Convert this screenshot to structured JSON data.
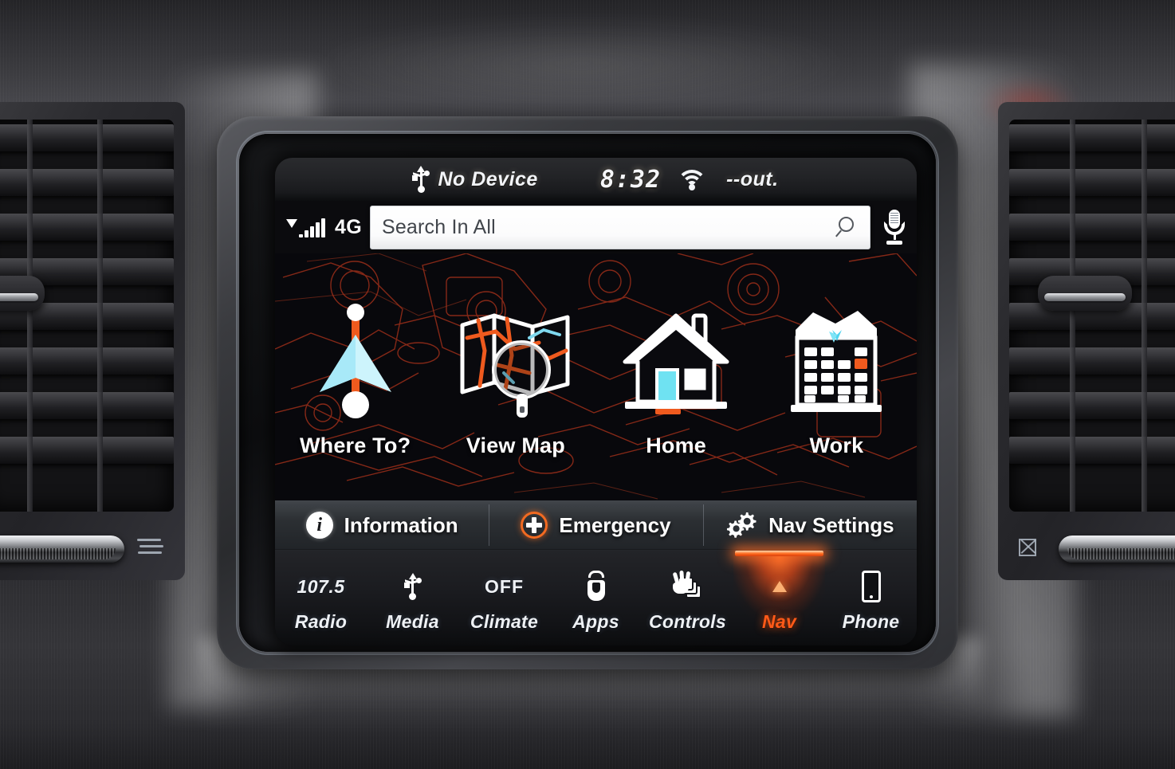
{
  "screen": {
    "status_bar": {
      "usb_icon": "usb-icon",
      "device_label": "No Device",
      "clock": "8:32",
      "wifi_icon": "wifi-icon",
      "outside_temp": "--out."
    },
    "search_row": {
      "signal_icon": "signal-bars-icon",
      "network_label": "4G",
      "search_placeholder": "Search In All",
      "search_value": "",
      "magnifier_icon": "search-icon",
      "mic_icon": "microphone-icon"
    },
    "nav_tiles": [
      {
        "label": "Where To?",
        "icon": "navigation-arrow-icon"
      },
      {
        "label": "View Map",
        "icon": "map-magnifier-icon"
      },
      {
        "label": "Home",
        "icon": "house-icon"
      },
      {
        "label": "Work",
        "icon": "office-building-icon"
      }
    ],
    "action_bar": [
      {
        "label": "Information",
        "icon": "info-circle-icon"
      },
      {
        "label": "Emergency",
        "icon": "emergency-plus-icon"
      },
      {
        "label": "Nav Settings",
        "icon": "gears-icon"
      }
    ],
    "tab_bar": [
      {
        "label": "Radio",
        "value": "107.5",
        "icon": "",
        "active": false
      },
      {
        "label": "Media",
        "value": "",
        "icon": "usb-icon",
        "active": false
      },
      {
        "label": "Climate",
        "value": "OFF",
        "icon": "",
        "active": false
      },
      {
        "label": "Apps",
        "value": "",
        "icon": "uconnect-u-icon",
        "active": false
      },
      {
        "label": "Controls",
        "value": "",
        "icon": "hand-seat-icon",
        "active": false
      },
      {
        "label": "Nav",
        "value": "",
        "icon": "nav-triangle-icon",
        "active": true
      },
      {
        "label": "Phone",
        "value": "",
        "icon": "phone-icon",
        "active": false
      }
    ]
  },
  "colors": {
    "accent_orange": "#f26a21",
    "active_nav": "#ff5a18",
    "tile_cyan": "#b8f0fb",
    "route_orange": "#ef5a1e",
    "screen_bg": "#08080c",
    "blueprint_line": "#8c2a18"
  },
  "dashboard": {
    "left_vent": "air-vent-left",
    "right_vent": "air-vent-right",
    "vent_direction_icon": "airflow-icon",
    "vent_close_icon": "vent-close-icon"
  }
}
